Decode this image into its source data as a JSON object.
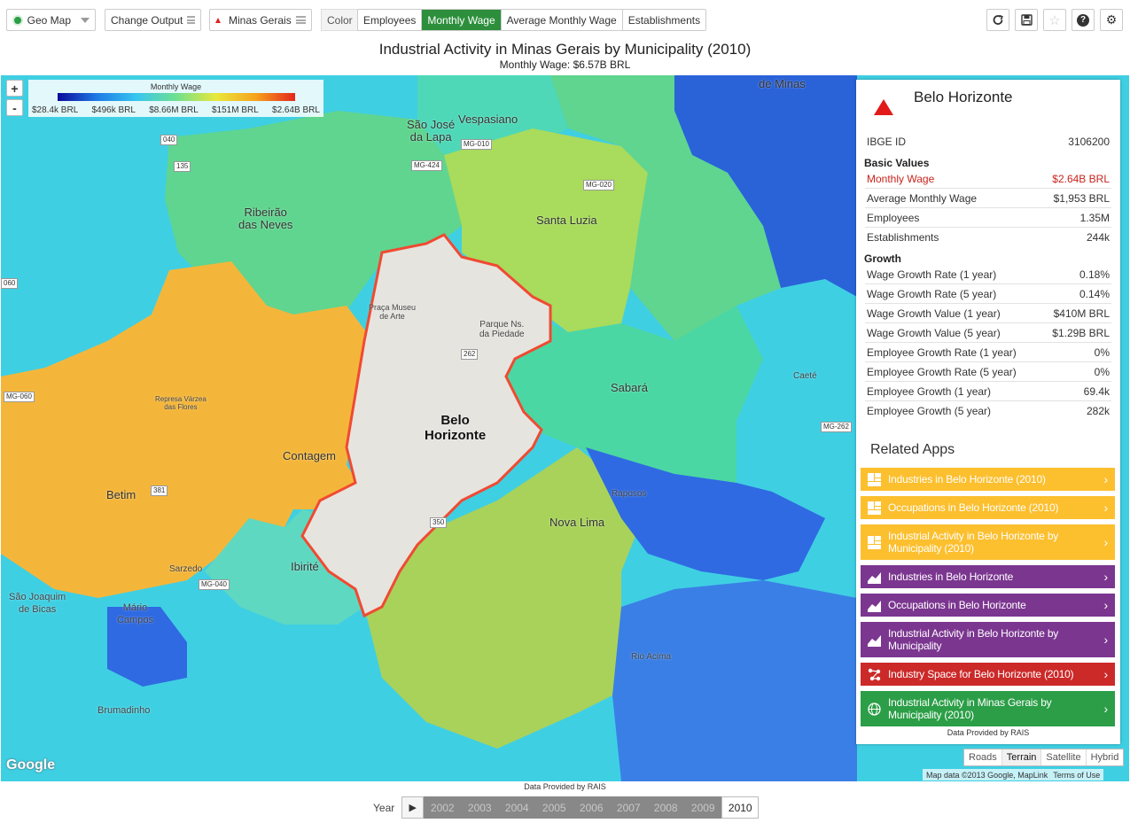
{
  "toolbar": {
    "app_type": "Geo Map",
    "change_output": "Change Output",
    "location": "Minas Gerais",
    "color_label": "Color",
    "color_options": [
      "Employees",
      "Monthly Wage",
      "Average Monthly Wage",
      "Establishments"
    ],
    "color_selected": "Monthly Wage",
    "right_icons": [
      "refresh-icon",
      "save-icon",
      "star-icon",
      "help-icon",
      "settings-icon"
    ]
  },
  "title": "Industrial Activity in Minas Gerais by Municipality (2010)",
  "subtitle": "Monthly Wage: $6.57B BRL",
  "legend": {
    "title": "Monthly Wage",
    "ticks": [
      "$28.4k BRL",
      "$496k BRL",
      "$8.66M BRL",
      "$151M BRL",
      "$2.64B BRL"
    ],
    "colors": [
      "#0a0a9a",
      "#1f7be6",
      "#36c6ef",
      "#6fe08f",
      "#e8e83a",
      "#f6a31d",
      "#e4261c"
    ]
  },
  "map_labels": {
    "ribeirao": "Ribeirão\ndas Neves",
    "santa_luzia": "Santa Luzia",
    "vespasiano": "Vespasiano",
    "sao_jose": "São José\nda Lapa",
    "de_minas": "de Minas",
    "sabara": "Sabará",
    "caete": "Caeté",
    "contagem": "Contagem",
    "betim": "Betim",
    "belo": "Belo\nHorizonte",
    "raposos": "Raposos",
    "nova_lima": "Nova Lima",
    "ibirite": "Ibirité",
    "sarzedo": "Sarzedo",
    "sao_joaquim": "São Joaquim\nde Bicas",
    "mario_campos": "Mário\nCampos",
    "rio_acima": "Rio Acima",
    "brumadinho": "Brumadinho",
    "represa": "Represa Várzea\ndas Flores",
    "praca": "Praça Museu\nde Arte",
    "parque": "Parque Ns.\nda Piedade"
  },
  "road_shields": [
    "MG-010",
    "MG-424",
    "MG-020",
    "040",
    "135",
    "381",
    "262",
    "060",
    "MG-060",
    "MG-040",
    "MG-262",
    "350"
  ],
  "map_controls": {
    "zoom_in": "+",
    "zoom_out": "-",
    "map_types": [
      "Roads",
      "Terrain",
      "Satellite",
      "Hybrid"
    ],
    "map_type_selected": "Terrain",
    "google": "Google",
    "attribution": "Map data ©2013 Google, MapLink",
    "terms": "Terms of Use"
  },
  "panel": {
    "name": "Belo Horizonte",
    "ibge_label": "IBGE ID",
    "ibge_value": "3106200",
    "basic_title": "Basic Values",
    "basic": [
      {
        "label": "Monthly Wage",
        "value": "$2.64B BRL"
      },
      {
        "label": "Average Monthly Wage",
        "value": "$1,953 BRL"
      },
      {
        "label": "Employees",
        "value": "1.35M"
      },
      {
        "label": "Establishments",
        "value": "244k"
      }
    ],
    "growth_title": "Growth",
    "growth": [
      {
        "label": "Wage Growth Rate (1 year)",
        "value": "0.18%"
      },
      {
        "label": "Wage Growth Rate (5 year)",
        "value": "0.14%"
      },
      {
        "label": "Wage Growth Value (1 year)",
        "value": "$410M BRL"
      },
      {
        "label": "Wage Growth Value (5 year)",
        "value": "$1.29B BRL"
      },
      {
        "label": "Employee Growth Rate (1 year)",
        "value": "0%"
      },
      {
        "label": "Employee Growth Rate (5 year)",
        "value": "0%"
      },
      {
        "label": "Employee Growth (1 year)",
        "value": "69.4k"
      },
      {
        "label": "Employee Growth (5 year)",
        "value": "282k"
      }
    ],
    "related_title": "Related Apps",
    "apps": [
      {
        "label": "Industries in Belo Horizonte (2010)",
        "color": "#fcbf2e"
      },
      {
        "label": "Occupations in Belo Horizonte (2010)",
        "color": "#fcbf2e"
      },
      {
        "label": "Industrial Activity in Belo Horizonte by Municipality (2010)",
        "color": "#fcbf2e"
      },
      {
        "label": "Industries in Belo Horizonte",
        "color": "#7b3690"
      },
      {
        "label": "Occupations in Belo Horizonte",
        "color": "#7b3690"
      },
      {
        "label": "Industrial Activity in Belo Horizonte by Municipality",
        "color": "#7b3690"
      },
      {
        "label": "Industry Space for Belo Horizonte (2010)",
        "color": "#cc2929"
      },
      {
        "label": "Industrial Activity in Minas Gerais by Municipality (2010)",
        "color": "#2b9e47"
      }
    ],
    "source": "Data Provided by RAIS"
  },
  "footer": {
    "source": "Data Provided by RAIS",
    "year_label": "Year",
    "years": [
      "2002",
      "2003",
      "2004",
      "2005",
      "2006",
      "2007",
      "2008",
      "2009",
      "2010"
    ],
    "selected_year": "2010"
  }
}
